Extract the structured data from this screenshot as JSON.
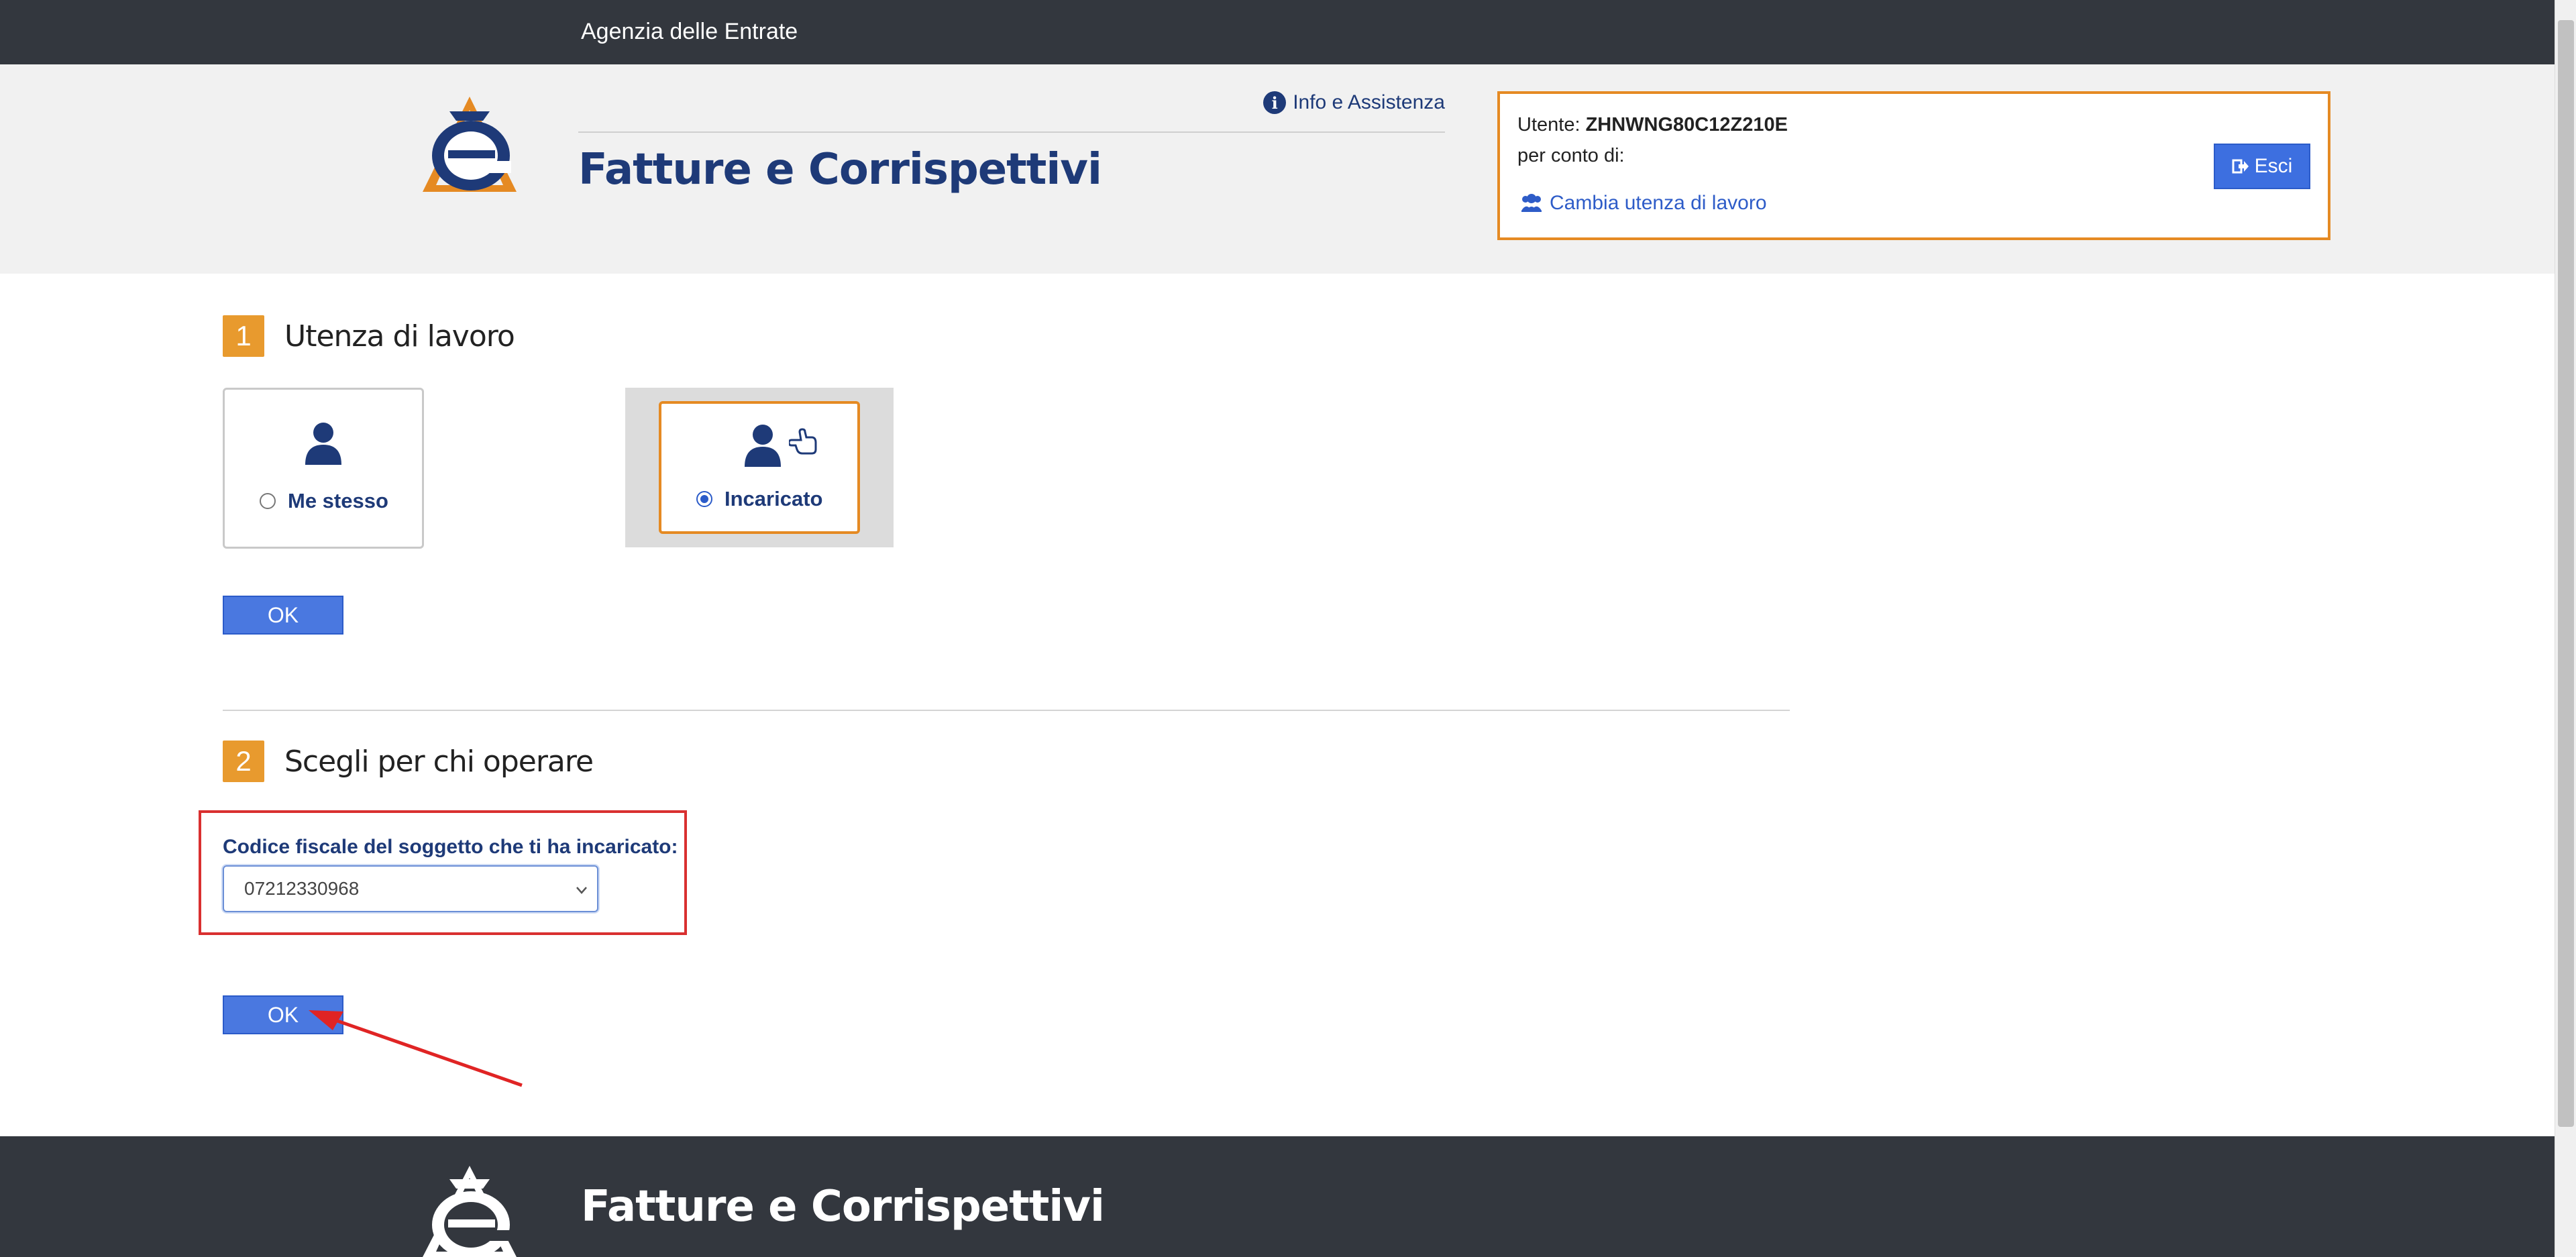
{
  "topbar": {
    "title": "Agenzia delle Entrate"
  },
  "header": {
    "brand_title": "Fatture e Corrispettivi",
    "info_link": "Info e Assistenza",
    "user_label": "Utente:",
    "user_code": "ZHNWNG80C12Z210E",
    "on_behalf_label": "per conto di:",
    "change_link": "Cambia utenza di lavoro",
    "logout_label": "Esci"
  },
  "step1": {
    "number": "1",
    "title": "Utenza di lavoro",
    "option_self": "Me stesso",
    "option_delegate": "Incaricato",
    "selected": "Incaricato",
    "ok_label": "OK"
  },
  "step2": {
    "number": "2",
    "title": "Scegli per chi operare",
    "field_label": "Codice fiscale del soggetto che ti ha incaricato:",
    "selected_value": "07212330968",
    "ok_label": "OK"
  },
  "footer": {
    "title": "Fatture e Corrispettivi"
  },
  "colors": {
    "dark_bar": "#33373e",
    "brand_blue": "#1e3a78",
    "accent_orange": "#e58a23",
    "button_blue": "#4a78e0",
    "highlight_red": "#d93030"
  }
}
